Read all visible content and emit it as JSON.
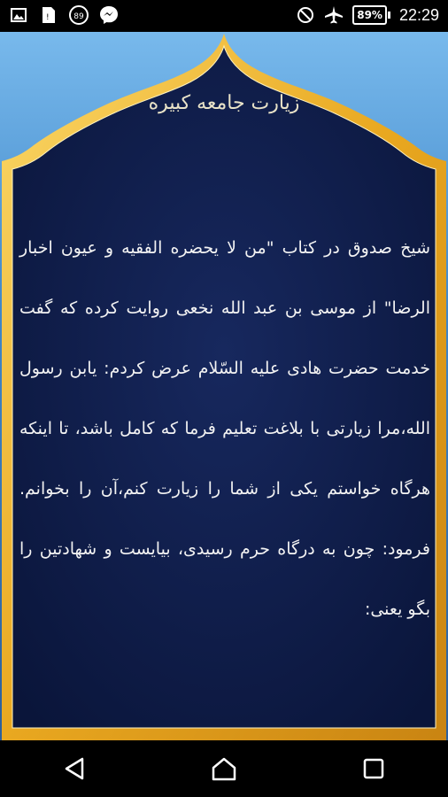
{
  "status_bar": {
    "notification_icons": [
      "image-icon",
      "sim-icon",
      "badge-89-icon",
      "messenger-icon"
    ],
    "badge_count": "89",
    "battery_percent": "89%",
    "time": "22:29"
  },
  "content": {
    "title": "زیارت جامعه کبیره",
    "body": "شیخ صدوق در کتاب \"من لا یحضره الفقیه و عیون اخبار الرضا\" از موسی بن عبد الله نخعی روایت کرده که گفت خدمت حضرت هادی علیه السّلام عرض کردم: یابن رسول الله،مرا زیارتی با بلاغت تعلیم فرما که کامل باشد، تا اینکه هرگاه خواستم یکی از شما را زیارت کنم،آن را بخوانم. فرمود: چون به درگاه حرم رسیدی، بیایست و شهادتین را بگو یعنی:"
  },
  "colors": {
    "frame_gold": "#f0b42a",
    "panel_navy": "#0d1b45",
    "sky_blue": "#5aa3e0"
  }
}
